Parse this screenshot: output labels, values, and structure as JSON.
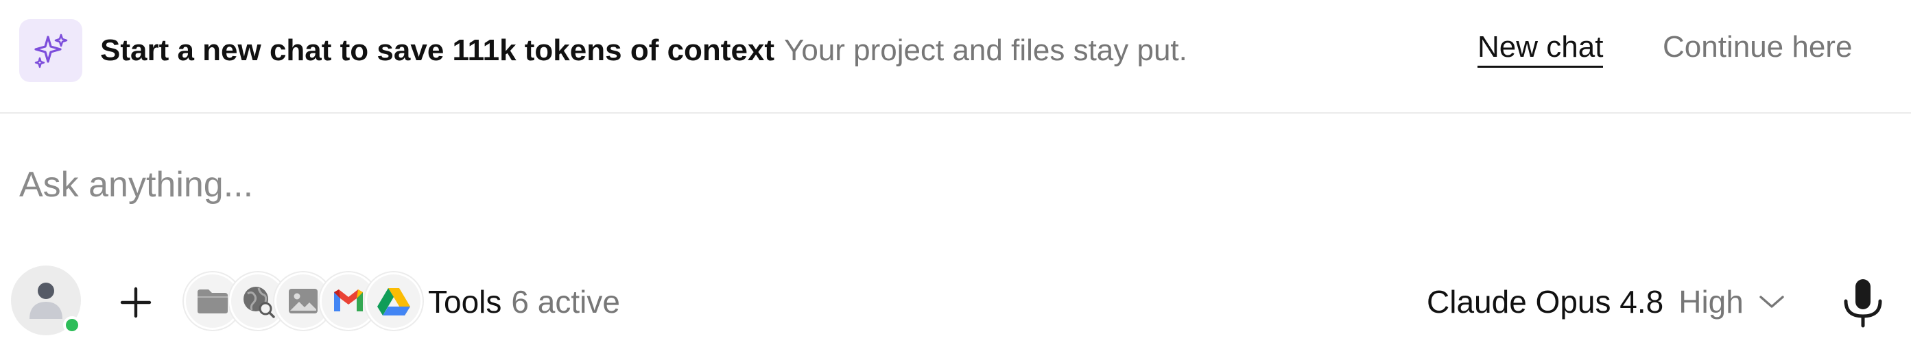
{
  "banner": {
    "icon": "sparkles-icon",
    "title": "Start a new chat to save 111k tokens of context",
    "subtitle": "Your project and files stay put.",
    "new_chat_label": "New chat",
    "continue_label": "Continue here",
    "accent_color": "#7c4ddb"
  },
  "composer": {
    "placeholder": "Ask anything..."
  },
  "toolbar": {
    "avatar_icon": "user-icon",
    "presence_color": "#2ebd59",
    "add_icon": "plus-icon",
    "tool_icons": [
      "folder-icon",
      "web-search-icon",
      "image-icon",
      "gmail-icon",
      "google-drive-icon"
    ],
    "tools_label": "Tools",
    "tools_count": "6 active",
    "model_name": "Claude Opus 4.8",
    "effort_label": "High",
    "mic_icon": "microphone-icon"
  }
}
